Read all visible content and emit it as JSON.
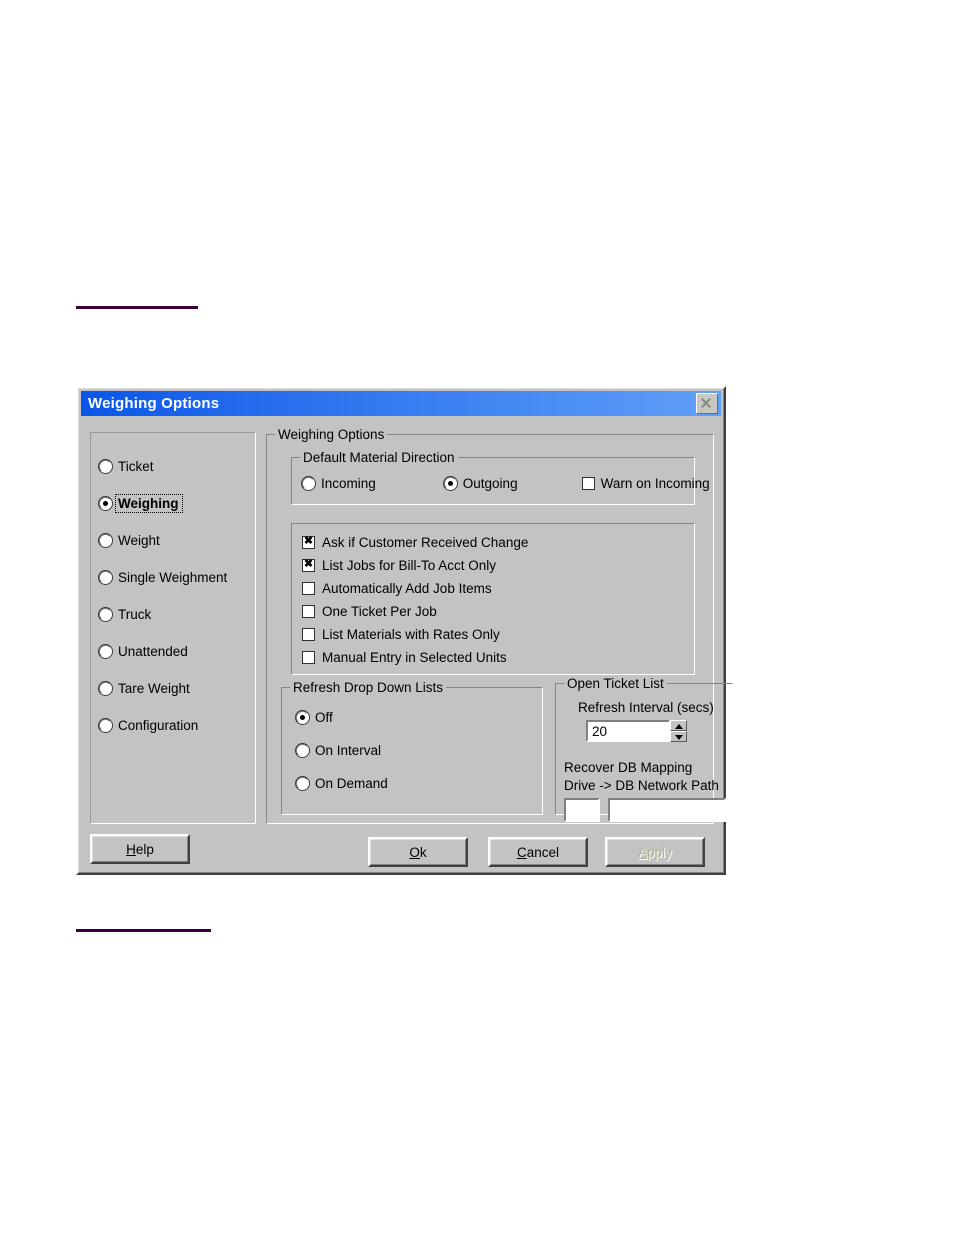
{
  "dialog": {
    "title": "Weighing Options",
    "close_icon": "close-icon"
  },
  "sidebar": {
    "items": [
      {
        "label": "Ticket",
        "selected": false
      },
      {
        "label": "Weighing",
        "selected": true
      },
      {
        "label": "Weight",
        "selected": false
      },
      {
        "label": "Single Weighment",
        "selected": false
      },
      {
        "label": "Truck",
        "selected": false
      },
      {
        "label": "Unattended",
        "selected": false
      },
      {
        "label": "Tare Weight",
        "selected": false
      },
      {
        "label": "Configuration",
        "selected": false
      }
    ]
  },
  "main": {
    "group_title": "Weighing Options",
    "direction": {
      "title": "Default Material Direction",
      "incoming": "Incoming",
      "outgoing": "Outgoing",
      "warn": "Warn on Incoming",
      "selected": "Outgoing",
      "warn_checked": false
    },
    "checkboxes": [
      {
        "label": "Ask if Customer Received Change",
        "checked": true
      },
      {
        "label": "List Jobs for Bill-To Acct Only",
        "checked": true
      },
      {
        "label": "Automatically Add Job Items",
        "checked": false
      },
      {
        "label": "One Ticket Per Job",
        "checked": false
      },
      {
        "label": "List Materials with Rates Only",
        "checked": false
      },
      {
        "label": "Manual Entry in Selected Units",
        "checked": false
      }
    ],
    "refresh": {
      "title": "Refresh Drop Down Lists",
      "options": [
        {
          "label": "Off",
          "selected": true
        },
        {
          "label": "On Interval",
          "selected": false
        },
        {
          "label": "On Demand",
          "selected": false
        }
      ]
    },
    "ticket_list": {
      "title": "Open Ticket List",
      "interval_label": "Refresh Interval (secs)",
      "interval_value": "20",
      "recover_label": "Recover DB Mapping",
      "drive_label": "Drive -> DB Network Path",
      "drive_value": "",
      "path_value": ""
    }
  },
  "buttons": {
    "help": "Help",
    "ok": "Ok",
    "cancel": "Cancel",
    "apply": "Apply"
  }
}
